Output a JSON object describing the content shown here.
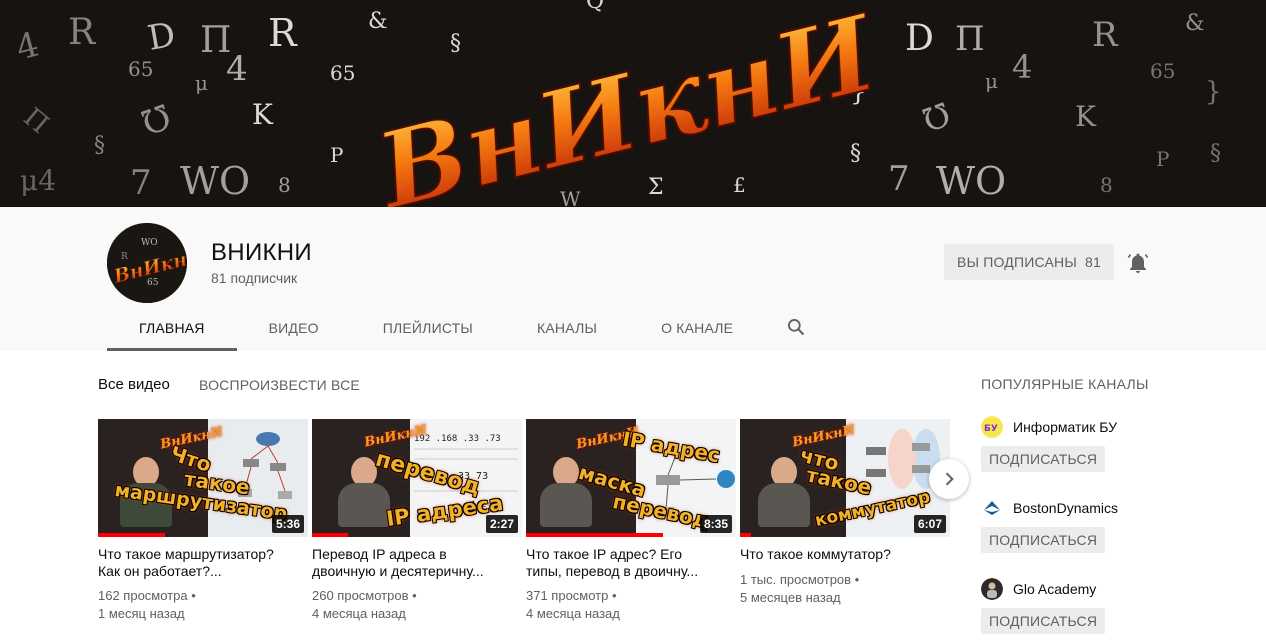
{
  "banner": {
    "logo_text": "ВнИкнИ",
    "glyphs": [
      "&",
      "R",
      "D",
      "П",
      "4",
      "μ",
      "65",
      "Ω",
      "K",
      "§",
      "P",
      "7",
      "WO",
      "8",
      "Σ",
      "£",
      "{"
    ]
  },
  "channel": {
    "name": "ВНИКНИ",
    "subscribers": "81 подписчик",
    "avatar_text": "ВнИкнИ",
    "subscribed_label": "ВЫ ПОДПИСАНЫ",
    "subscribed_count": "81"
  },
  "tabs": [
    {
      "label": "ГЛАВНАЯ",
      "active": true
    },
    {
      "label": "ВИДЕО",
      "active": false
    },
    {
      "label": "ПЛЕЙЛИСТЫ",
      "active": false
    },
    {
      "label": "КАНАЛЫ",
      "active": false
    },
    {
      "label": "О КАНАЛЕ",
      "active": false
    }
  ],
  "section": {
    "title": "Все видео",
    "play_all": "ВОСПРОИЗВЕСТИ ВСЕ"
  },
  "videos": [
    {
      "title_line1": "Что такое маршрутизатор?",
      "title_line2": "Как он работает?...",
      "views": "162 просмотра •",
      "age": "1 месяц назад",
      "duration": "5:36",
      "thumb_words": [
        "Что",
        "такое",
        "маршрутизатор"
      ],
      "progress": 0.32
    },
    {
      "title_line1": "Перевод IP адреса в",
      "title_line2": "двоичную и десятеричну...",
      "views": "260 просмотров •",
      "age": "4 месяца назад",
      "duration": "2:27",
      "thumb_words": [
        "перевод",
        "IP адреса"
      ],
      "progress": 0.17
    },
    {
      "title_line1": "Что такое IP адрес? Его",
      "title_line2": "типы, перевод в двоичну...",
      "views": "371 просмотр •",
      "age": "4 месяца назад",
      "duration": "8:35",
      "thumb_words": [
        "IP адрес",
        "маска",
        "перевод"
      ],
      "progress": 0.65
    },
    {
      "title_line1": "Что такое коммутатор?",
      "title_line2": "",
      "views": "1 тыс. просмотров •",
      "age": "5 месяцев назад",
      "duration": "6:07",
      "thumb_words": [
        "что",
        "такое",
        "коммутатор"
      ],
      "progress": 0.05
    }
  ],
  "sidebar": {
    "title": "ПОПУЛЯРНЫЕ КАНАЛЫ",
    "subscribe_label": "ПОДПИСАТЬСЯ",
    "channels": [
      {
        "name": "Информатик БУ",
        "icon": "informatik-bu-icon"
      },
      {
        "name": "BostonDynamics",
        "icon": "boston-dynamics-icon"
      },
      {
        "name": "Glo Academy",
        "icon": "glo-academy-icon"
      }
    ]
  },
  "colors": {
    "accent_red": "#ff0000",
    "banner_bg": "#161311",
    "flame_orange": "#f5a020"
  }
}
